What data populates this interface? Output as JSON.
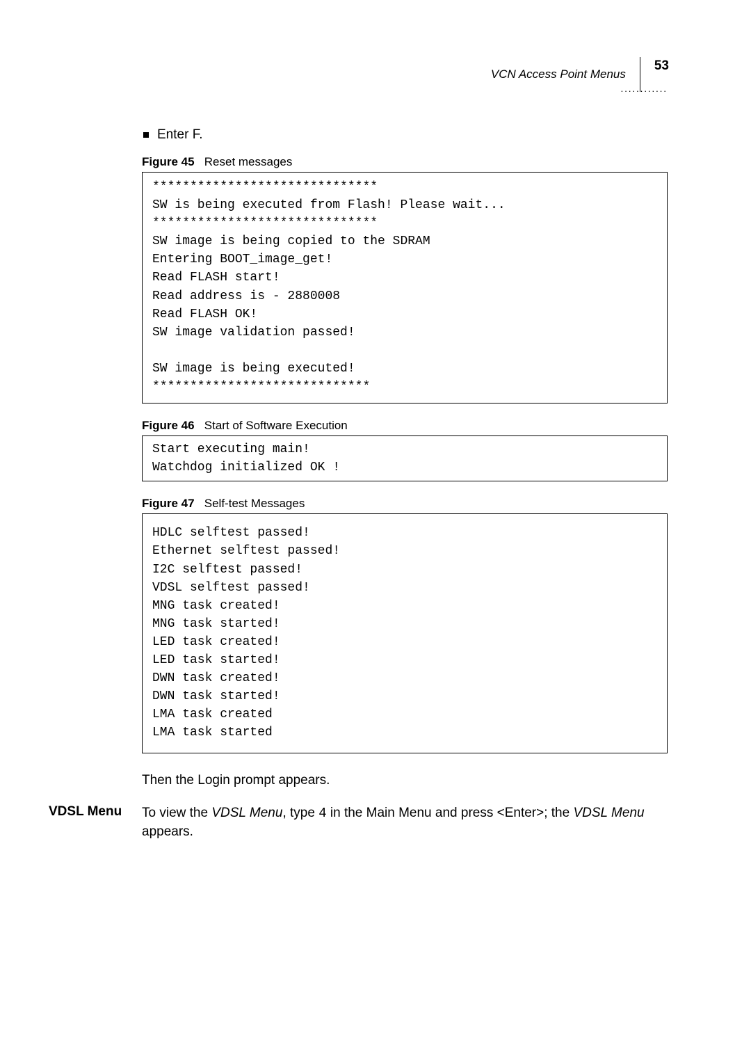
{
  "header": {
    "title": "VCN Access Point Menus",
    "page_number": "53",
    "dots": "............"
  },
  "bullet": {
    "text": "Enter F."
  },
  "fig45": {
    "label": "Figure 45",
    "title": "Reset messages",
    "code": "******************************\nSW is being executed from Flash! Please wait...\n******************************\nSW image is being copied to the SDRAM\nEntering BOOT_image_get!\nRead FLASH start!\nRead address is - 2880008\nRead FLASH OK!\nSW image validation passed!\n\nSW image is being executed!\n*****************************"
  },
  "fig46": {
    "label": "Figure 46",
    "title": "Start of Software Execution",
    "code": "Start executing main!\nWatchdog initialized OK !"
  },
  "fig47": {
    "label": "Figure 47",
    "title": "Self-test Messages",
    "code": "HDLC selftest passed!\nEthernet selftest passed!\nI2C selftest passed!\nVDSL selftest passed!\nMNG task created!\nMNG task started!\nLED task created!\nLED task started!\nDWN task created!\nDWN task started!\nLMA task created\nLMA task started"
  },
  "login_text": "Then the Login prompt appears.",
  "vdsl": {
    "heading": "VDSL Menu",
    "pre1": "To view the ",
    "ital1": "VDSL Menu",
    "mid1": ", type ",
    "code": "4",
    "mid2": " in the Main Menu and press <Enter>; the ",
    "ital2": "VDSL Menu",
    "post": " appears."
  }
}
